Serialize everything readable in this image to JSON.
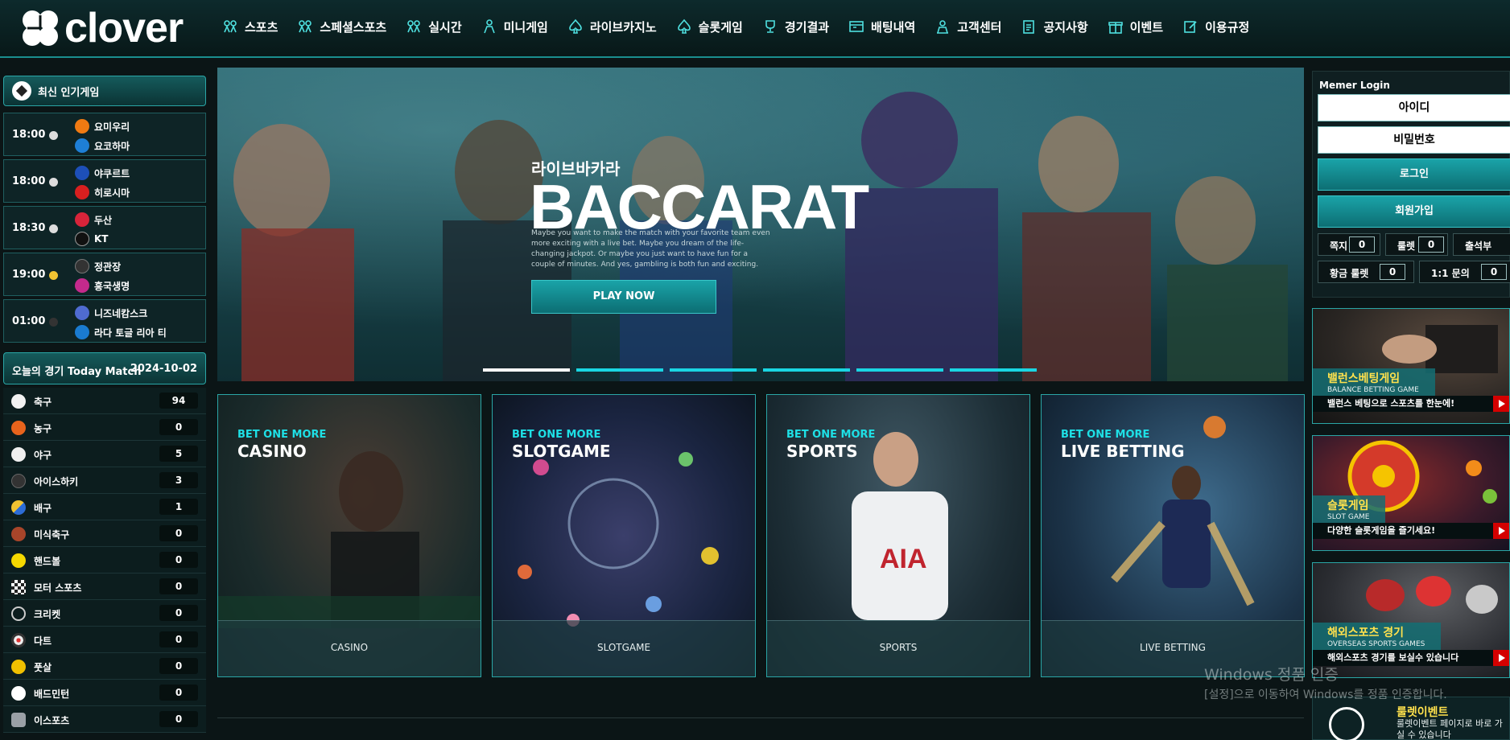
{
  "brand": {
    "name": "clover"
  },
  "nav": [
    {
      "label": "스포츠",
      "icon": "soccer-players-icon"
    },
    {
      "label": "스페셜스포츠",
      "icon": "soccer-players-icon"
    },
    {
      "label": "실시간",
      "icon": "soccer-players-icon"
    },
    {
      "label": "미니게임",
      "icon": "person-icon"
    },
    {
      "label": "라이브카지노",
      "icon": "spade-icon"
    },
    {
      "label": "슬롯게임",
      "icon": "spade-icon"
    },
    {
      "label": "경기결과",
      "icon": "trophy-icon"
    },
    {
      "label": "배팅내역",
      "icon": "ledger-icon"
    },
    {
      "label": "고객센터",
      "icon": "headset-icon"
    },
    {
      "label": "공지사항",
      "icon": "clipboard-icon"
    },
    {
      "label": "이벤트",
      "icon": "gift-icon"
    },
    {
      "label": "이용규정",
      "icon": "edit-icon"
    }
  ],
  "popular": {
    "title": "최신 인기게임",
    "games": [
      {
        "time": "18:00",
        "home": "요미우리",
        "away": "요코하마",
        "home_color": "#f07a12",
        "away_color": "#1e7fd6"
      },
      {
        "time": "18:00",
        "home": "야쿠르트",
        "away": "히로시마",
        "home_color": "#1d4fb8",
        "away_color": "#d81f1f"
      },
      {
        "time": "18:30",
        "home": "두산",
        "away": "KT",
        "home_color": "#d8243a",
        "away_color": "#111111"
      },
      {
        "time": "19:00",
        "home": "정관장",
        "away": "흥국생명",
        "home_color": "#333333",
        "away_color": "#c42a8c"
      },
      {
        "time": "01:00",
        "home": "니즈네캄스크",
        "away": "라다 토글 리아 티",
        "home_color": "#4f6bd1",
        "away_color": "#1a7bd0"
      }
    ]
  },
  "today": {
    "title": "오늘의 경기 Today Match",
    "date": "2024-10-02"
  },
  "sports": [
    {
      "label": "축구",
      "count": "94",
      "color": "#f2f2f2"
    },
    {
      "label": "농구",
      "count": "0",
      "color": "#e8631c"
    },
    {
      "label": "야구",
      "count": "5",
      "color": "#f0f0f0"
    },
    {
      "label": "아이스하키",
      "count": "3",
      "color": "#333333"
    },
    {
      "label": "배구",
      "count": "1",
      "color": "#f1c232"
    },
    {
      "label": "미식축구",
      "count": "0",
      "color": "#a8452a"
    },
    {
      "label": "핸드볼",
      "count": "0",
      "color": "#f5d800"
    },
    {
      "label": "모터 스포츠",
      "count": "0",
      "color": "#dddddd"
    },
    {
      "label": "크리켓",
      "count": "0",
      "color": "#cccccc"
    },
    {
      "label": "다트",
      "count": "0",
      "color": "#d9d9d9"
    },
    {
      "label": "풋살",
      "count": "0",
      "color": "#f0c000"
    },
    {
      "label": "배드민턴",
      "count": "0",
      "color": "#ffffff"
    },
    {
      "label": "이스포츠",
      "count": "0",
      "color": "#9aa0a6"
    }
  ],
  "hero": {
    "sub": "라이브바카라",
    "title": "BACCARAT",
    "desc": "Maybe you want to make the match with your favorite team even more exciting with a live bet. Maybe you dream of the life-changing jackpot. Or maybe you just want to have fun for a couple of minutes. And yes, gambling is both fun and exciting.",
    "cta": "PLAY NOW",
    "slides": 6,
    "active_slide": 1
  },
  "cards": [
    {
      "kicker": "BET ONE MORE",
      "title": "CASINO",
      "footer": "CASINO"
    },
    {
      "kicker": "BET ONE MORE",
      "title": "SLOTGAME",
      "footer": "SLOTGAME"
    },
    {
      "kicker": "BET ONE MORE",
      "title": "SPORTS",
      "footer": "SPORTS"
    },
    {
      "kicker": "BET ONE MORE",
      "title": "LIVE BETTING",
      "footer": "LIVE BETTING"
    }
  ],
  "login": {
    "title": "Memer Login",
    "id_placeholder": "아이디",
    "pw_placeholder": "비밀번호",
    "login_label": "로그인",
    "join_label": "회원가입",
    "stats": [
      {
        "label": "쪽지",
        "value": "0"
      },
      {
        "label": "룰렛",
        "value": "0"
      },
      {
        "label": "출석부",
        "value": ""
      },
      {
        "label": "황금 룰렛",
        "value": "0"
      },
      {
        "label": "1:1 문의",
        "value": "0"
      }
    ]
  },
  "promos": [
    {
      "title": "밸런스베팅게임",
      "subtitle": "BALANCE BETTING GAME",
      "caption": "밸런스 베팅으로 스포츠를 한눈에!"
    },
    {
      "title": "슬롯게임",
      "subtitle": "SLOT GAME",
      "caption": "다양한 슬롯게임을 즐기세요!"
    },
    {
      "title": "해외스포츠 경기",
      "subtitle": "OVERSEAS SPORTS GAMES",
      "caption": "해외스포츠 경기를 보실수 있습니다"
    }
  ],
  "roulette_event": {
    "title": "룰렛이벤트",
    "desc": "룰렛이벤트 페이지로 바로 가실 수 있습니다"
  },
  "windows_notice": {
    "line1": "Windows 정품 인증",
    "line2": "[설정]으로 이동하여 Windows를 정품 인증합니다."
  }
}
